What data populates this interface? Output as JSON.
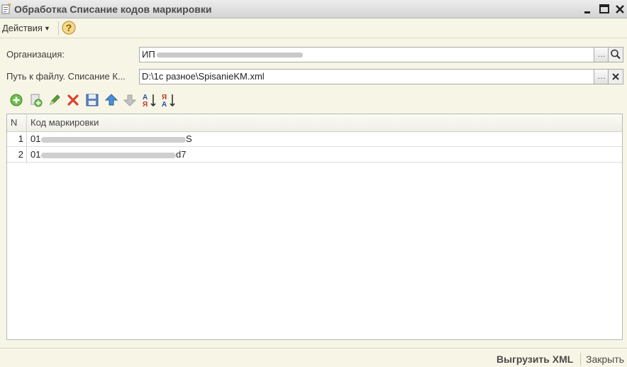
{
  "window": {
    "title": "Обработка  Списание кодов маркировки"
  },
  "command_bar": {
    "actions_label": "Действия"
  },
  "form": {
    "organization_label": "Организация:",
    "organization_value": "ИП",
    "file_path_label": "Путь к файлу. Списание К...",
    "file_path_value": "D:\\1с разное\\SpisanieKM.xml"
  },
  "table": {
    "columns": [
      "N",
      "Код маркировки"
    ],
    "rows": [
      {
        "n": "1",
        "code": "01",
        "code_tail": "S"
      },
      {
        "n": "2",
        "code": "01",
        "code_tail": "d7"
      }
    ]
  },
  "footer": {
    "export_label": "Выгрузить XML",
    "close_label": "Закрыть"
  },
  "icons": {
    "add": "add-icon",
    "copy": "copy-icon",
    "edit": "edit-icon",
    "delete": "delete-icon",
    "save": "save-icon",
    "move_up": "move-up-icon",
    "move_down": "move-down-icon",
    "sort_asc": "sort-ascending-icon",
    "sort_desc": "sort-descending-icon"
  },
  "colors": {
    "background": "#f7f5e6",
    "titlebar": "#d4d4d4"
  }
}
